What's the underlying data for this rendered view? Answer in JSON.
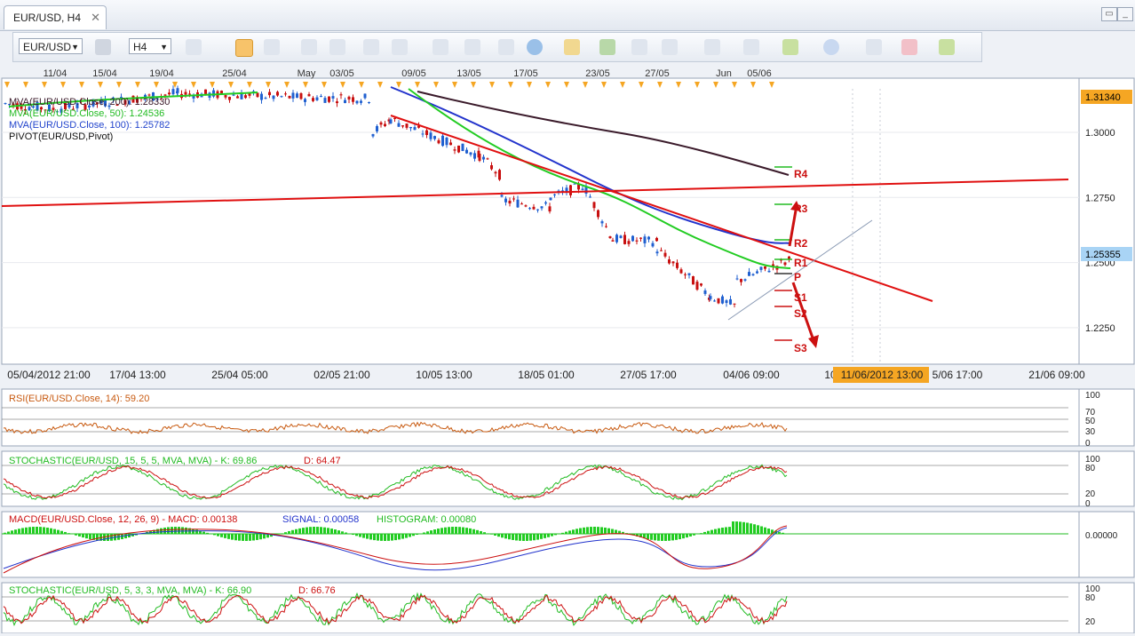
{
  "tab": {
    "title": "EUR/USD, H4",
    "close": "✕"
  },
  "toolbar": {
    "symbol": "EUR/USD",
    "timeframe": "H4"
  },
  "top_dates": [
    "11/04",
    "15/04",
    "19/04",
    "25/04",
    "May",
    "03/05",
    "09/05",
    "13/05",
    "17/05",
    "23/05",
    "27/05",
    "Jun",
    "05/06"
  ],
  "bottom_dates": [
    "05/04/2012 21:00",
    "17/04 13:00",
    "25/04 05:00",
    "02/05 21:00",
    "10/05 13:00",
    "18/05 01:00",
    "27/05 17:00",
    "04/06 09:00",
    "10",
    "11/06/2012 13:00",
    "5/06 17:00",
    "21/06 09:00"
  ],
  "price_axis": [
    "1.3000",
    "1.2750",
    "1.2500",
    "1.2250"
  ],
  "price_tags": {
    "top": "1.31340",
    "current": "1.25355"
  },
  "legend": [
    {
      "text": "MVA(EUR/USD.Close, 200): 1.28330",
      "color": "#3a1a2a"
    },
    {
      "text": "MVA(EUR/USD.Close, 50): 1.24536",
      "color": "#22bb22"
    },
    {
      "text": "MVA(EUR/USD.Close, 100): 1.25782",
      "color": "#2244cc"
    },
    {
      "text": "PIVOT(EUR/USD,Pivot)",
      "color": "#111111"
    }
  ],
  "pivot_labels": [
    "R4",
    "R3",
    "R2",
    "R1",
    "P",
    "S1",
    "S2",
    "S3"
  ],
  "panels": {
    "rsi": {
      "label": "RSI(EUR/USD.Close, 14): 59.20",
      "color": "#c85a10",
      "axis": [
        "100",
        "70",
        "50",
        "30",
        "0"
      ]
    },
    "stoch1": {
      "label": "STOCHASTIC(EUR/USD, 15, 5, 5, MVA, MVA) -  K: 69.86",
      "d_label": "D: 64.47",
      "axis": [
        "100",
        "80",
        "20",
        "0"
      ]
    },
    "macd": {
      "label": "MACD(EUR/USD.Close, 12, 26, 9) -  MACD: 0.00138",
      "signal": "SIGNAL: 0.00058",
      "hist": "HISTOGRAM: 0.00080",
      "axis": [
        "0.00000"
      ]
    },
    "stoch2": {
      "label": "STOCHASTIC(EUR/USD, 5, 3, 3, MVA, MVA) -  K: 66.90",
      "d_label": "D: 66.76",
      "axis": [
        "100",
        "80",
        "20"
      ]
    }
  },
  "colors": {
    "ma200": "#3a1a2a",
    "ma50": "#22cc22",
    "ma100": "#2233cc",
    "trend": "#e01010",
    "candle": "#c81010",
    "candle_up": "#2060d0",
    "highlight": "#f5a623"
  }
}
